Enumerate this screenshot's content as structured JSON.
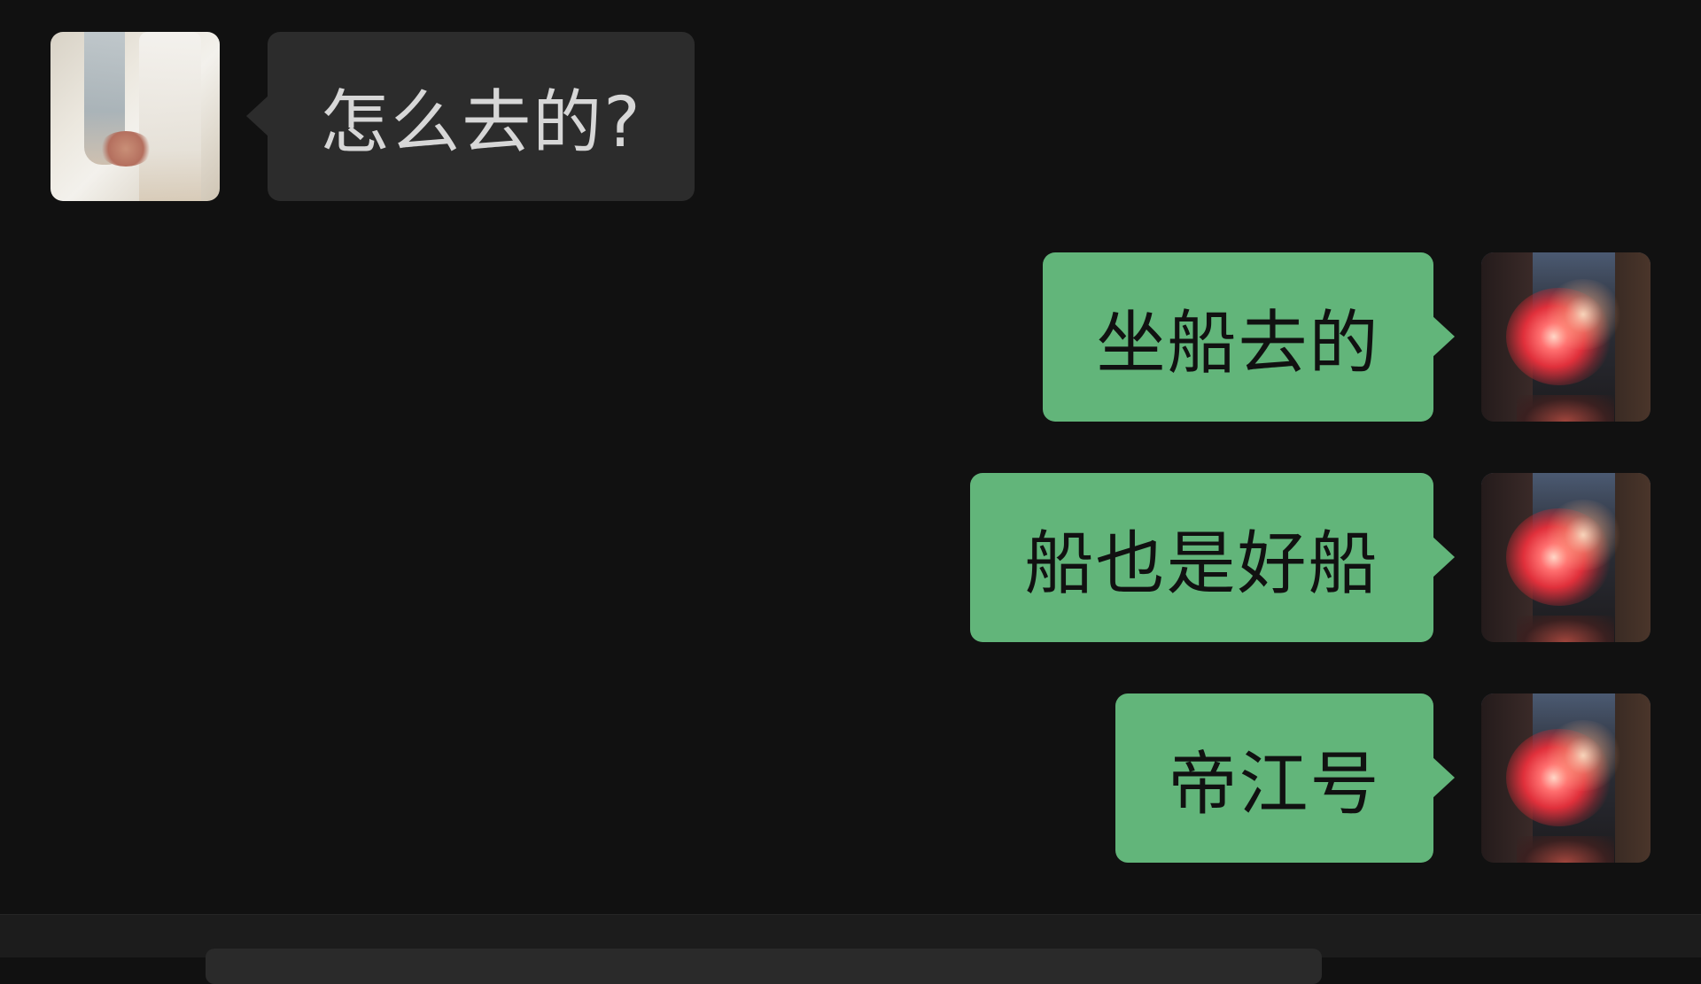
{
  "conversation": {
    "messages": [
      {
        "direction": "incoming",
        "avatar": "couple-hands-avatar",
        "text": "怎么去的?"
      },
      {
        "direction": "outgoing",
        "avatar": "fireworks-avatar",
        "text": "坐船去的"
      },
      {
        "direction": "outgoing",
        "avatar": "fireworks-avatar",
        "text": "船也是好船"
      },
      {
        "direction": "outgoing",
        "avatar": "fireworks-avatar",
        "text": "帝江号"
      }
    ]
  },
  "colors": {
    "background": "#111111",
    "incoming_bubble": "#2c2c2c",
    "outgoing_bubble": "#62b57a",
    "incoming_text": "#d7d7d7",
    "outgoing_text": "#111111"
  }
}
